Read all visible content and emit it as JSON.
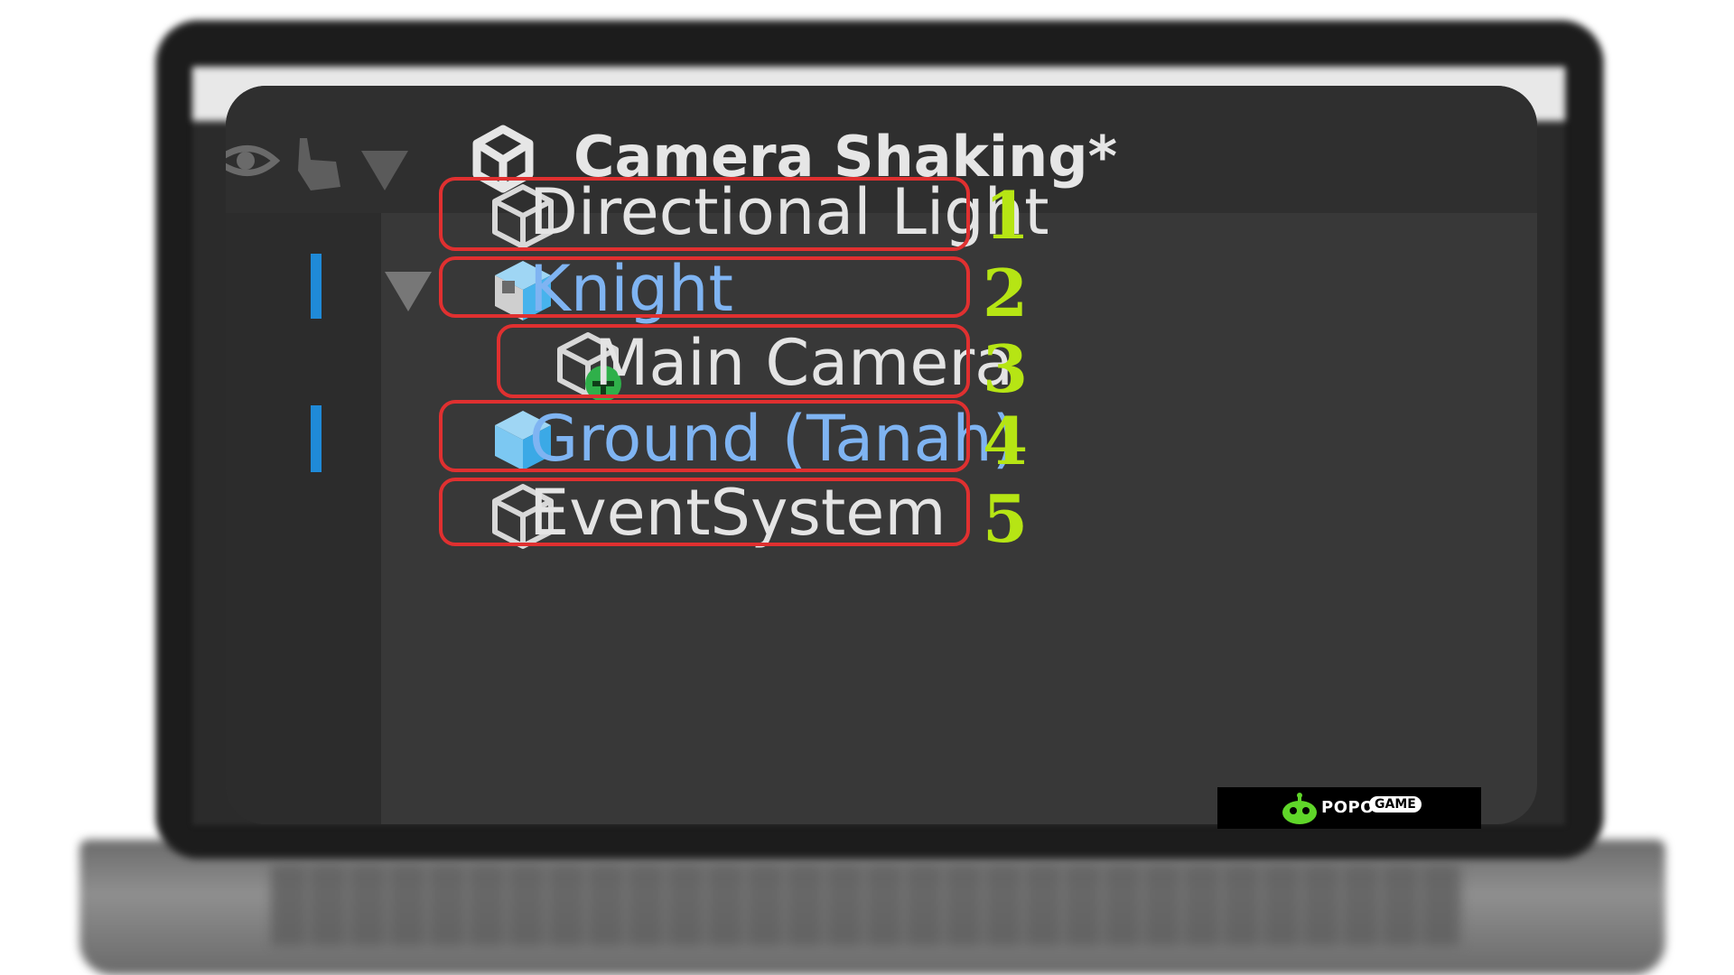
{
  "hierarchy": {
    "scene_title": "Camera Shaking*",
    "items": [
      {
        "label": "Directional Light",
        "icon": "cube-outline-icon",
        "number": "1"
      },
      {
        "label": "Knight",
        "icon": "prefab-cube-icon",
        "number": "2"
      },
      {
        "label": "Main Camera",
        "icon": "cube-plus-icon",
        "number": "3"
      },
      {
        "label": "Ground (Tanah)",
        "icon": "prefab-cube-icon",
        "number": "4"
      },
      {
        "label": "EventSystem",
        "icon": "cube-outline-icon",
        "number": "5"
      }
    ]
  },
  "watermark": {
    "brand": "POPO",
    "brand_suffix": "GAME"
  },
  "colors": {
    "highlight_border": "#e03030",
    "number_color": "#b6e514",
    "prefab_text": "#7fb4f2",
    "selection_bar": "#1f8ad8"
  }
}
